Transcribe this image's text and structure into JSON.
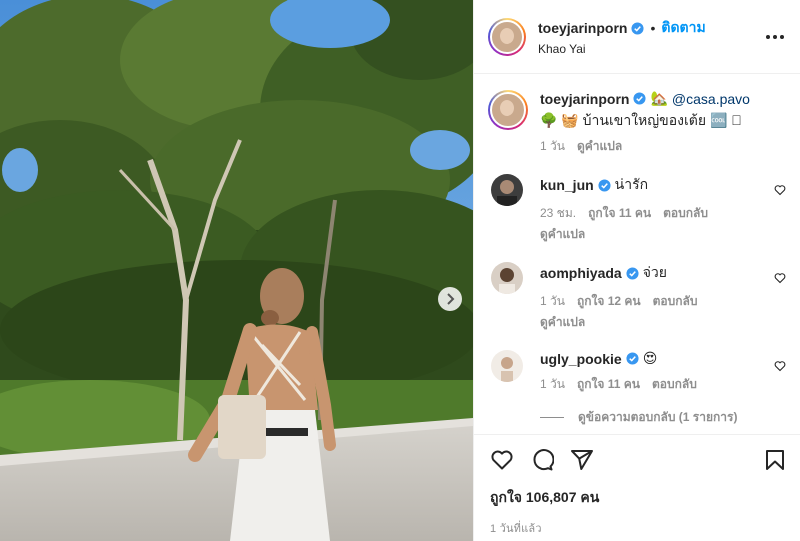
{
  "post": {
    "username": "toeyjarinporn",
    "follow_label": "ติดตาม",
    "separator": "•",
    "location": "Khao Yai"
  },
  "caption": {
    "username": "toeyjarinporn",
    "house_emoji": "🏡",
    "mention": "@casa.pavo",
    "text_emoji_tree": "🌳",
    "text_emoji_basket": "🧺",
    "text": "บ้านเขาใหญ่ของเต้ย",
    "text_emoji_tail": "🆒 🏻",
    "age": "1 วัน",
    "translate": "ดูคำแปล"
  },
  "comments": [
    {
      "username": "kun_jun",
      "text": "น่ารัก",
      "age": "23 ชม.",
      "likes": "ถูกใจ 11 คน",
      "reply": "ตอบกลับ",
      "translate": "ดูคำแปล"
    },
    {
      "username": "aomphiyada",
      "text": "จ่วย",
      "age": "1 วัน",
      "likes": "ถูกใจ 12 คน",
      "reply": "ตอบกลับ",
      "translate": "ดูคำแปล"
    },
    {
      "username": "ugly_pookie",
      "text": "😍",
      "age": "1 วัน",
      "likes": "ถูกใจ 11 คน",
      "reply": "ตอบกลับ",
      "translate": ""
    }
  ],
  "view_replies": "ดูข้อความตอบกลับ (1 รายการ)",
  "footer": {
    "likes": "ถูกใจ 106,807 คน",
    "time": "1 วันที่แล้ว"
  },
  "icons": {
    "verified": "verified-badge-icon",
    "more": "more-options-icon",
    "like": "heart-icon",
    "comment": "comment-icon",
    "share": "share-icon",
    "save": "bookmark-icon",
    "next": "chevron-right-icon"
  },
  "colors": {
    "accent": "#0095f6",
    "verified": "#3897f0",
    "muted": "#8e8e8e",
    "text": "#262626"
  }
}
